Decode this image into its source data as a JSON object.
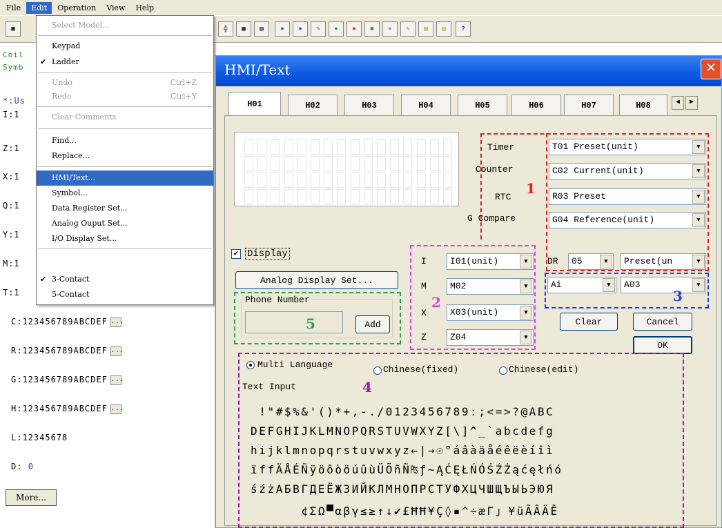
{
  "menubar": {
    "items": [
      "File",
      "Edit",
      "Operation",
      "View",
      "Help"
    ]
  },
  "left_panel": {
    "coil": "Coil",
    "symb": "Symb",
    "usage": "*:Us",
    "rows": [
      "I:1",
      "Z:1",
      "X:1",
      "Q:1",
      "Y:1",
      "M:1",
      "T:1"
    ],
    "c_row": "C:123456789ABCDEF",
    "r_row": "R:123456789ABCDEF",
    "g_row": "G:123456789ABCDEF",
    "h_row": "H:123456789ABCDEF",
    "l_row": "L:12345678",
    "d_label": "D:",
    "d_value": "0",
    "more_button": "More..."
  },
  "edit_menu": {
    "select_model": "Select Model...",
    "keypad": "Keypad",
    "ladder": "Ladder",
    "undo": "Undo",
    "undo_sc": "Ctrl+Z",
    "redo": "Redo",
    "redo_sc": "Ctrl+Y",
    "clear_comments": "Clear Comments",
    "find": "Find...",
    "replace": "Replace...",
    "hmi_text": "HMI/Text...",
    "symbol": "Symbol...",
    "data_register": "Data Register Set...",
    "analog_output": "Analog Ouput Set...",
    "io_display": "I/O Display Set...",
    "three_contact": "3-Contact",
    "five_contact": "5-Contact",
    "check": "✔"
  },
  "dialog": {
    "title": "HMI/Text",
    "tabs": [
      "H01",
      "H02",
      "H03",
      "H04",
      "H05",
      "H06",
      "H07",
      "H08"
    ],
    "timer_label": "Timer",
    "counter_label": "Counter",
    "rtc_label": "RTC",
    "gcompare_label": "G Compare",
    "timer_value": "T01 Preset(unit)",
    "counter_value": "C02 Current(unit)",
    "rtc_value": "R03 Preset",
    "gcompare_value": "G04 Reference(unit)",
    "display_checkbox": "Display",
    "analog_button": "Analog Display Set...",
    "phone_group": "Phone Number",
    "add_button": "Add",
    "i_label": "I",
    "m_label": "M",
    "x_label": "X",
    "z_label": "Z",
    "i_value": "I01(unit)",
    "m_value": "M02",
    "x_value": "X03(unit)",
    "z_value": "Z04",
    "dr_label": "DR",
    "dr_value": "05",
    "dr_mode": "Preset(un",
    "ai_value": "Ai",
    "a03_value": "A03",
    "clear_button": "Clear",
    "cancel_button": "Cancel",
    "ok_button": "OK",
    "multi_language": "Multi Language",
    "chinese_fixed": "Chinese(fixed)",
    "chinese_edit": "Chinese(edit)",
    "text_input": "Text Input",
    "char_rows": [
      " !\"#$%&'()*+,-./0123456789:;<=>?@ABC",
      "DEFGHIJKLMNOPQRSTUVWXYZ[\\]^_`abcdefg",
      "hijklmnopqrstuvwxyz←|→☉°áâàäåéêëèíîì",
      "ïffÄÅÉÑÿöôòöúûùÜÕñÑ₧ƒ~ĄĆĘŁŃÓŚŹŻąćęłńó",
      "śźżАБВГДЕЁЖЗИЙКЛМНОПРСТУФХЦЧШЩЪЫЬЭЮЯ",
      "      ¢ΣΩ▀αβγ≤≥↑↓✔£ĦĦ¥Ç◊▪^÷æΓ」¥üÃÂÄÊ"
    ],
    "annotations": [
      "1",
      "2",
      "3",
      "4",
      "5"
    ]
  },
  "colors": {
    "red": "#e02020",
    "pink": "#e040e0",
    "blue": "#2040e0",
    "purple": "#9020a0",
    "green": "#30a050"
  }
}
